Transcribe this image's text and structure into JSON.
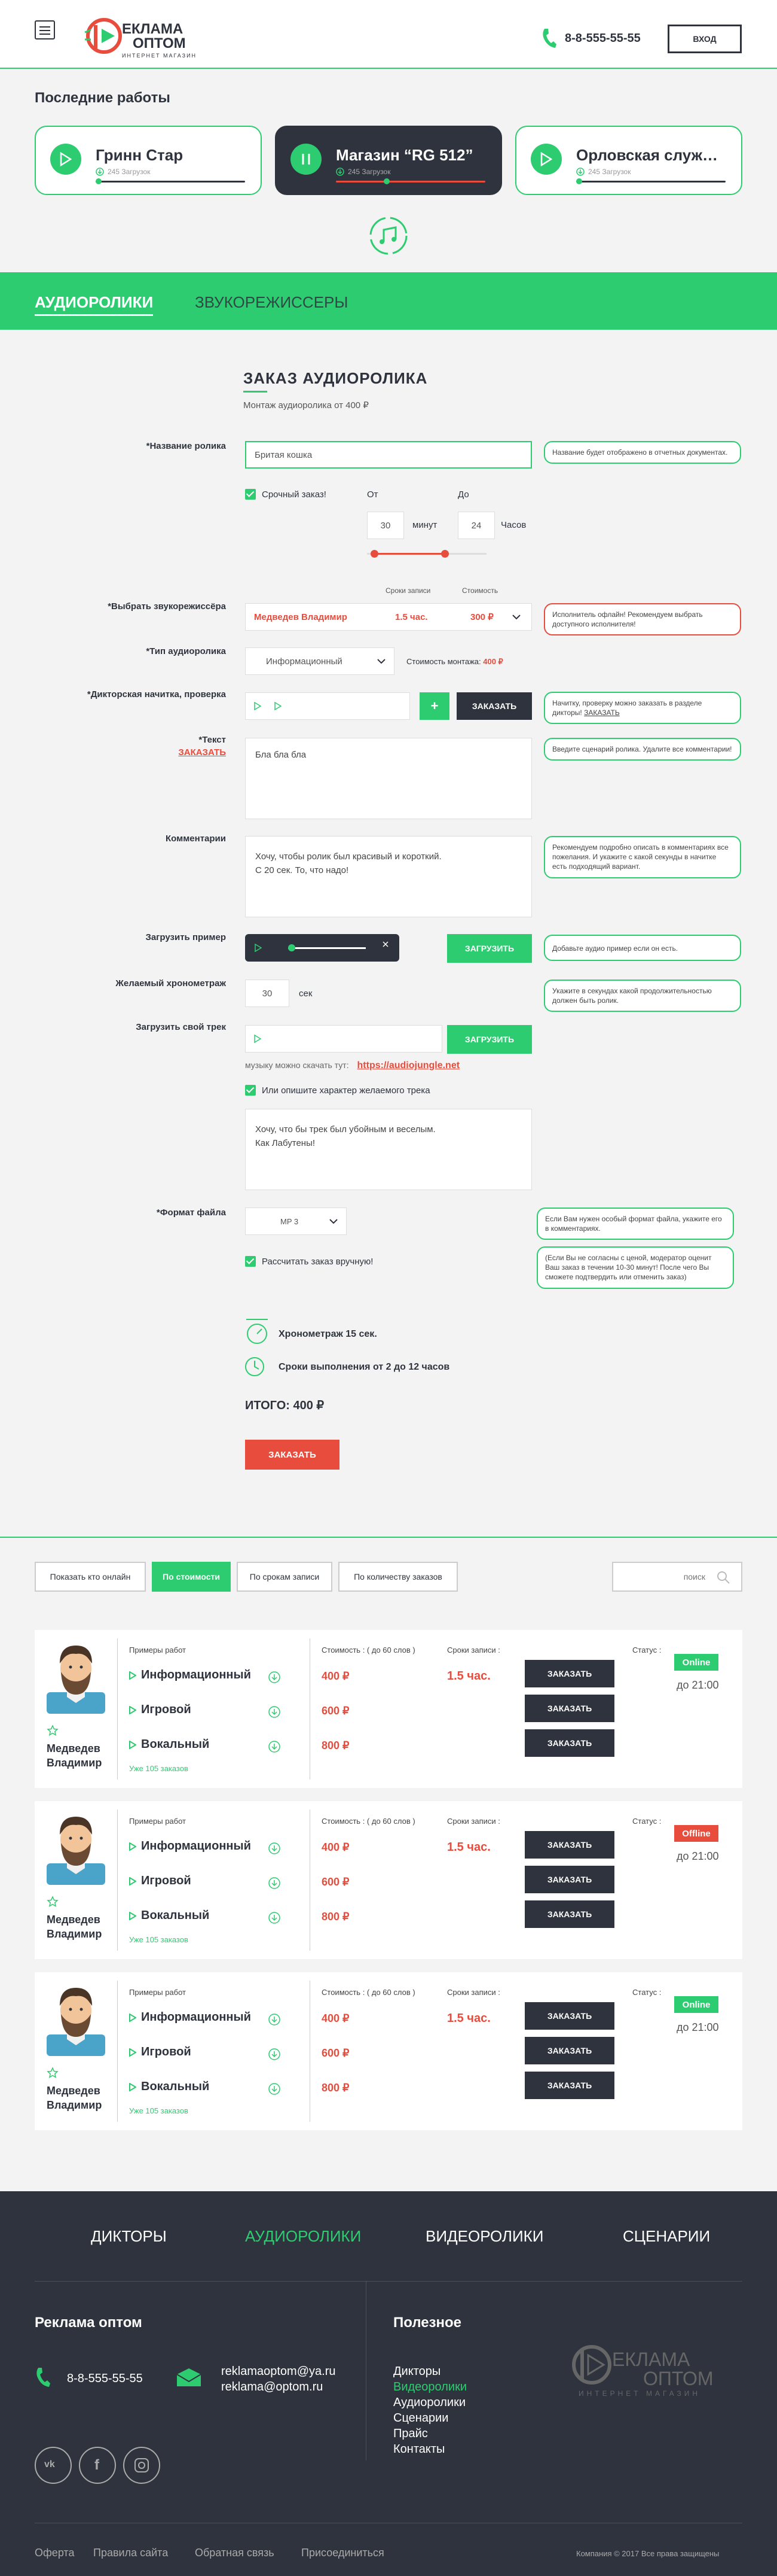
{
  "header": {
    "logo_text_1": "Реклама",
    "logo_text_2": "оптом",
    "logo_tagline": "интернет магазин",
    "phone": "8-8-555-55-55",
    "login_label": "ВХОД"
  },
  "recent": {
    "title": "Последние работы",
    "cards": [
      {
        "name": "Гринн Стар",
        "downloads": "245 Загрузок"
      },
      {
        "name": "Магазин “RG 512”",
        "downloads": "245 Загрузок"
      },
      {
        "name": "Орловская служ…",
        "downloads": "245 Загрузок"
      }
    ]
  },
  "tabs": {
    "active": "АУДИОРОЛИКИ",
    "inactive": "ЗВУКОРЕЖИССЕРЫ"
  },
  "form": {
    "title": "ЗАКАЗ АУДИОРОЛИКА",
    "subtitle": "Монтаж аудиоролика от 400 ₽",
    "name_label": "*Название ролика",
    "name_value": "Бритая кошка",
    "name_tip": "Название будет отображено в отчетных документах.",
    "urgent_label": "Срочный заказ!",
    "from_label": "От",
    "to_label": "До",
    "from_value": "30",
    "from_unit": "минут",
    "to_value": "24",
    "to_unit": "Часов",
    "engineer_label": "*Выбрать звукорежиссёра",
    "col_terms": "Сроки записи",
    "col_cost": "Стоимость",
    "engineer_name": "Медведев Владимир",
    "engineer_term": "1.5 час.",
    "engineer_cost": "300 ₽",
    "engineer_tip": "Исполнитель офлайн! Рекомендуем выбрать доступного исполнителя!",
    "type_label": "*Тип аудиоролика",
    "type_value": "Информационный",
    "mount_cost_label": "Стоимость монтажа:",
    "mount_cost_value": "400 ₽",
    "intro_label": "*Дикторская начитка, проверка",
    "intro_order": "ЗАКАЗАТЬ",
    "intro_tip": "Начитку, проверку можно заказать в разделе дикторы!",
    "intro_tip_link": "ЗАКАЗАТЬ",
    "text_label": "*Текст",
    "text_order": "ЗАКАЗАТЬ",
    "text_value": "Бла бла бла",
    "text_tip": "Введите сценарий ролика. Удалите все комментарии!",
    "comment_label": "Комментарии",
    "comment_line1": "Хочу, чтобы ролик был красивый и короткий.",
    "comment_line2": "С 20 сек. То, что надо!",
    "comment_tip": "Рекомендуем подробно описать в комментариях все пожелания. И укажите с какой секунды в начитке есть подходящий вариант.",
    "sample_label": "Загрузить пример",
    "upload_label": "ЗАГРУЗИТЬ",
    "sample_tip": "Добавьте аудио пример если он есть.",
    "chrono_label": "Желаемый хронометраж",
    "chrono_value": "30",
    "chrono_unit": "сек",
    "chrono_tip": "Укажите в секундах какой продолжительностью должен быть ролик.",
    "track_label": "Загрузить свой трек",
    "track_upload": "ЗАГРУЗИТЬ",
    "music_hint": "музыку можно скачать тут:",
    "music_link": "https://audiojungle.net",
    "describe_label": "Или опишите характер желаемого трека",
    "track_line1": "Хочу, что бы трек был убойным и веселым.",
    "track_line2": "Как Лабутены!",
    "format_label": "*Формат файла",
    "format_value": "MP 3",
    "format_tip": "Если Вам нужен особый формат файла, укажите его в комментариях.",
    "manual_label": "Рассчитать заказ вручную!",
    "manual_tip": "(Если Вы не согласны с ценой, модератор оценит Ваш заказ в течении 10-30 минут! После чего Вы сможете подтвердить или отменить заказ)",
    "chrono_summary": "Хронометраж 15 сек.",
    "terms_summary": "Сроки выполнения от 2 до 12 часов",
    "total": "ИТОГО: 400 ₽",
    "order_button": "ЗАКАЗАТЬ"
  },
  "filters": {
    "items": [
      "Показать кто онлайн",
      "По стоимости",
      "По срокам записи",
      "По количеству заказов"
    ],
    "search_placeholder": "поиск"
  },
  "performers": {
    "col_examples": "Примеры работ",
    "col_cost": "Стоимость : ( до 60 слов )",
    "col_terms": "Сроки записи :",
    "col_status": "Статус :",
    "examples": [
      "Информационный",
      "Игровой",
      "Вокальный"
    ],
    "prices": [
      "400 ₽",
      "600 ₽",
      "800 ₽"
    ],
    "order_label": "ЗАКАЗАТЬ",
    "list": [
      {
        "first": "Медведев",
        "last": "Владимир",
        "term": "1.5 час.",
        "status": "Online",
        "until": "до 21:00",
        "orders": "Уже 105 заказов"
      },
      {
        "first": "Медведев",
        "last": "Владимир",
        "term": "1.5 час.",
        "status": "Offline",
        "until": "до 21:00",
        "orders": "Уже 105 заказов"
      },
      {
        "first": "Медведев",
        "last": "Владимир",
        "term": "1.5 час.",
        "status": "Online",
        "until": "до 21:00",
        "orders": "Уже 105 заказов"
      }
    ]
  },
  "footer": {
    "nav": [
      "ДИКТОРЫ",
      "АУДИОРОЛИКИ",
      "ВИДЕОРОЛИКИ",
      "СЦЕНАРИИ"
    ],
    "company": "Реклама оптом",
    "phone": "8-8-555-55-55",
    "email1": "reklamaoptom@ya.ru",
    "email2": "reklama@optom.ru",
    "useful_title": "Полезное",
    "useful": [
      "Дикторы",
      "Видеоролики",
      "Аудиоролики",
      "Сценарии",
      "Прайс",
      "Контакты"
    ],
    "bottom_links": [
      "Оферта",
      "Правила сайта",
      "Обратная связь",
      "Присоединиться"
    ],
    "copyright": "Компания © 2017 Все права защищены"
  },
  "colors": {
    "accent": "#2ecc71",
    "dark": "#2e333d",
    "alert": "#e74c3c"
  }
}
